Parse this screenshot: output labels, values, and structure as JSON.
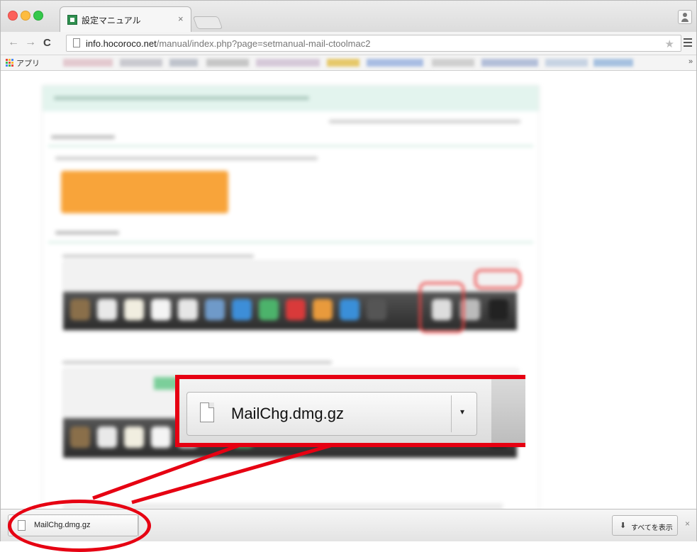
{
  "tab": {
    "title": "設定マニュアル",
    "close": "×"
  },
  "nav": {
    "back": "←",
    "forward": "→",
    "reload": "C"
  },
  "address": {
    "host": "info.hocoroco.net",
    "path": "/manual/index.php?page=setmanual-mail-ctoolmac2",
    "star": "★"
  },
  "bookmarks": {
    "apps_label": "アプリ",
    "more": "»"
  },
  "callout": {
    "filename": "MailChg.dmg.gz",
    "arrow": "▾"
  },
  "download_shelf": {
    "item_name": "MailChg.dmg.gz",
    "show_all_icon": "⬇",
    "show_all_label": "すべてを表示",
    "close": "×"
  },
  "colors": {
    "annotation_red": "#e60012",
    "accent_green": "#e3f4ee",
    "orange_button": "#f8a43a"
  }
}
